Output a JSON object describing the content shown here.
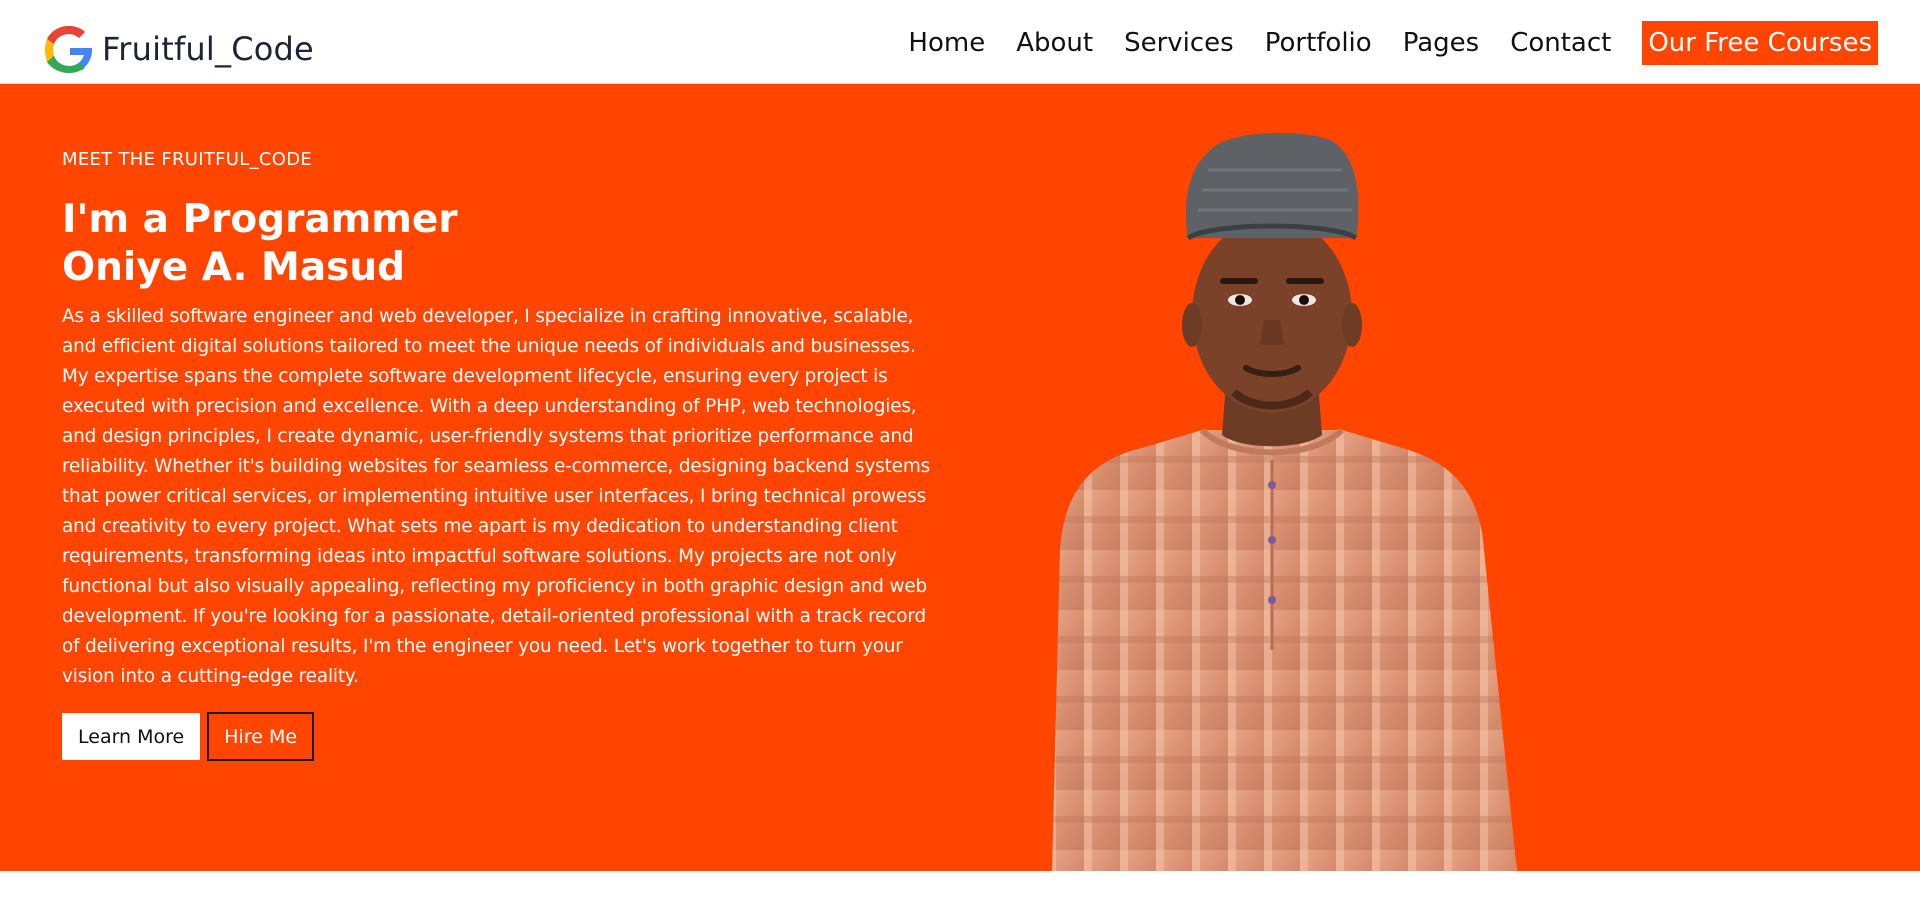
{
  "brand": {
    "name": "Fruitful_Code",
    "logo_icon": "google-g-logo",
    "logo_colors": [
      "#4285F4",
      "#EA4335",
      "#FBBC05",
      "#34A853"
    ]
  },
  "nav": {
    "items": [
      {
        "label": "Home"
      },
      {
        "label": "About"
      },
      {
        "label": "Services"
      },
      {
        "label": "Portfolio"
      },
      {
        "label": "Pages"
      },
      {
        "label": "Contact"
      }
    ],
    "cta_label": "Our Free Courses"
  },
  "hero": {
    "eyebrow": "MEET THE FRUITFUL_CODE",
    "title_line1": "I'm a Programmer",
    "title_line2": "Oniye A. Masud",
    "description": "As a skilled software engineer and web developer, I specialize in crafting innovative, scalable, and efficient digital solutions tailored to meet the unique needs of individuals and businesses. My expertise spans the complete software development lifecycle, ensuring every project is executed with precision and excellence. With a deep understanding of PHP, web technologies, and design principles, I create dynamic, user-friendly systems that prioritize performance and reliability. Whether it's building websites for seamless e-commerce, designing backend systems that power critical services, or implementing intuitive user interfaces, I bring technical prowess and creativity to every project. What sets me apart is my dedication to understanding client requirements, transforming ideas into impactful software solutions. My projects are not only functional but also visually appealing, reflecting my proficiency in both graphic design and web development. If you're looking for a passionate, detail-oriented professional with a track record of delivering exceptional results, I'm the engineer you need. Let's work together to turn your vision into a cutting-edge reality.",
    "primary_button": "Learn More",
    "secondary_button": "Hire Me",
    "portrait_icon": "person-portrait",
    "accent_color": "#FF4500"
  }
}
